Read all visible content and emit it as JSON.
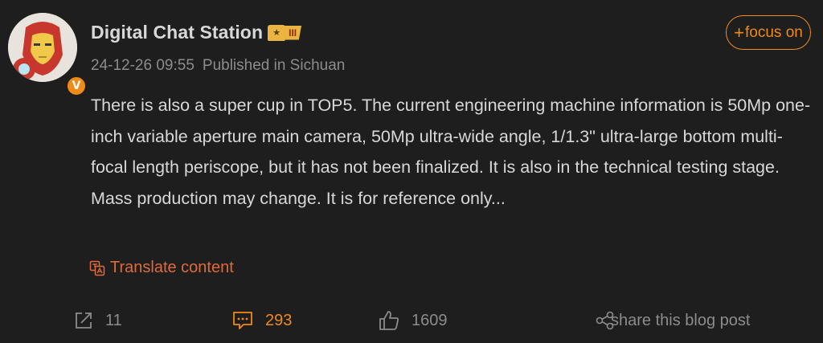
{
  "author": {
    "name": "Digital Chat Station",
    "level_badge": "III",
    "verified_mark": "V",
    "timestamp": "24-12-26 09:55",
    "location": "Published in Sichuan"
  },
  "follow_button": {
    "plus": "+",
    "label": "focus on"
  },
  "post": {
    "text": "There is also a super cup in TOP5. The current engineering machine information is 50Mp one-inch variable aperture main camera, 50Mp ultra-wide angle, 1/1.3\" ultra-large bottom multi-focal length periscope, but it has not been finalized. It is also in the technical testing stage. Mass production may change. It is for reference only..."
  },
  "translate": {
    "label": "Translate content"
  },
  "actions": {
    "share_count": "11",
    "comment_count": "293",
    "like_count": "1609",
    "share_blog_label": "share this blog post"
  },
  "colors": {
    "background": "#1e1e1e",
    "accent": "#f08a18",
    "translate": "#e06a3a",
    "text": "#d8d8d8",
    "muted": "#8c8c8c"
  },
  "icons": [
    "avatar-ironman",
    "verified-icon",
    "crown-badge-icon",
    "translate-icon",
    "share-icon",
    "comment-icon",
    "like-icon",
    "share-nodes-icon"
  ]
}
